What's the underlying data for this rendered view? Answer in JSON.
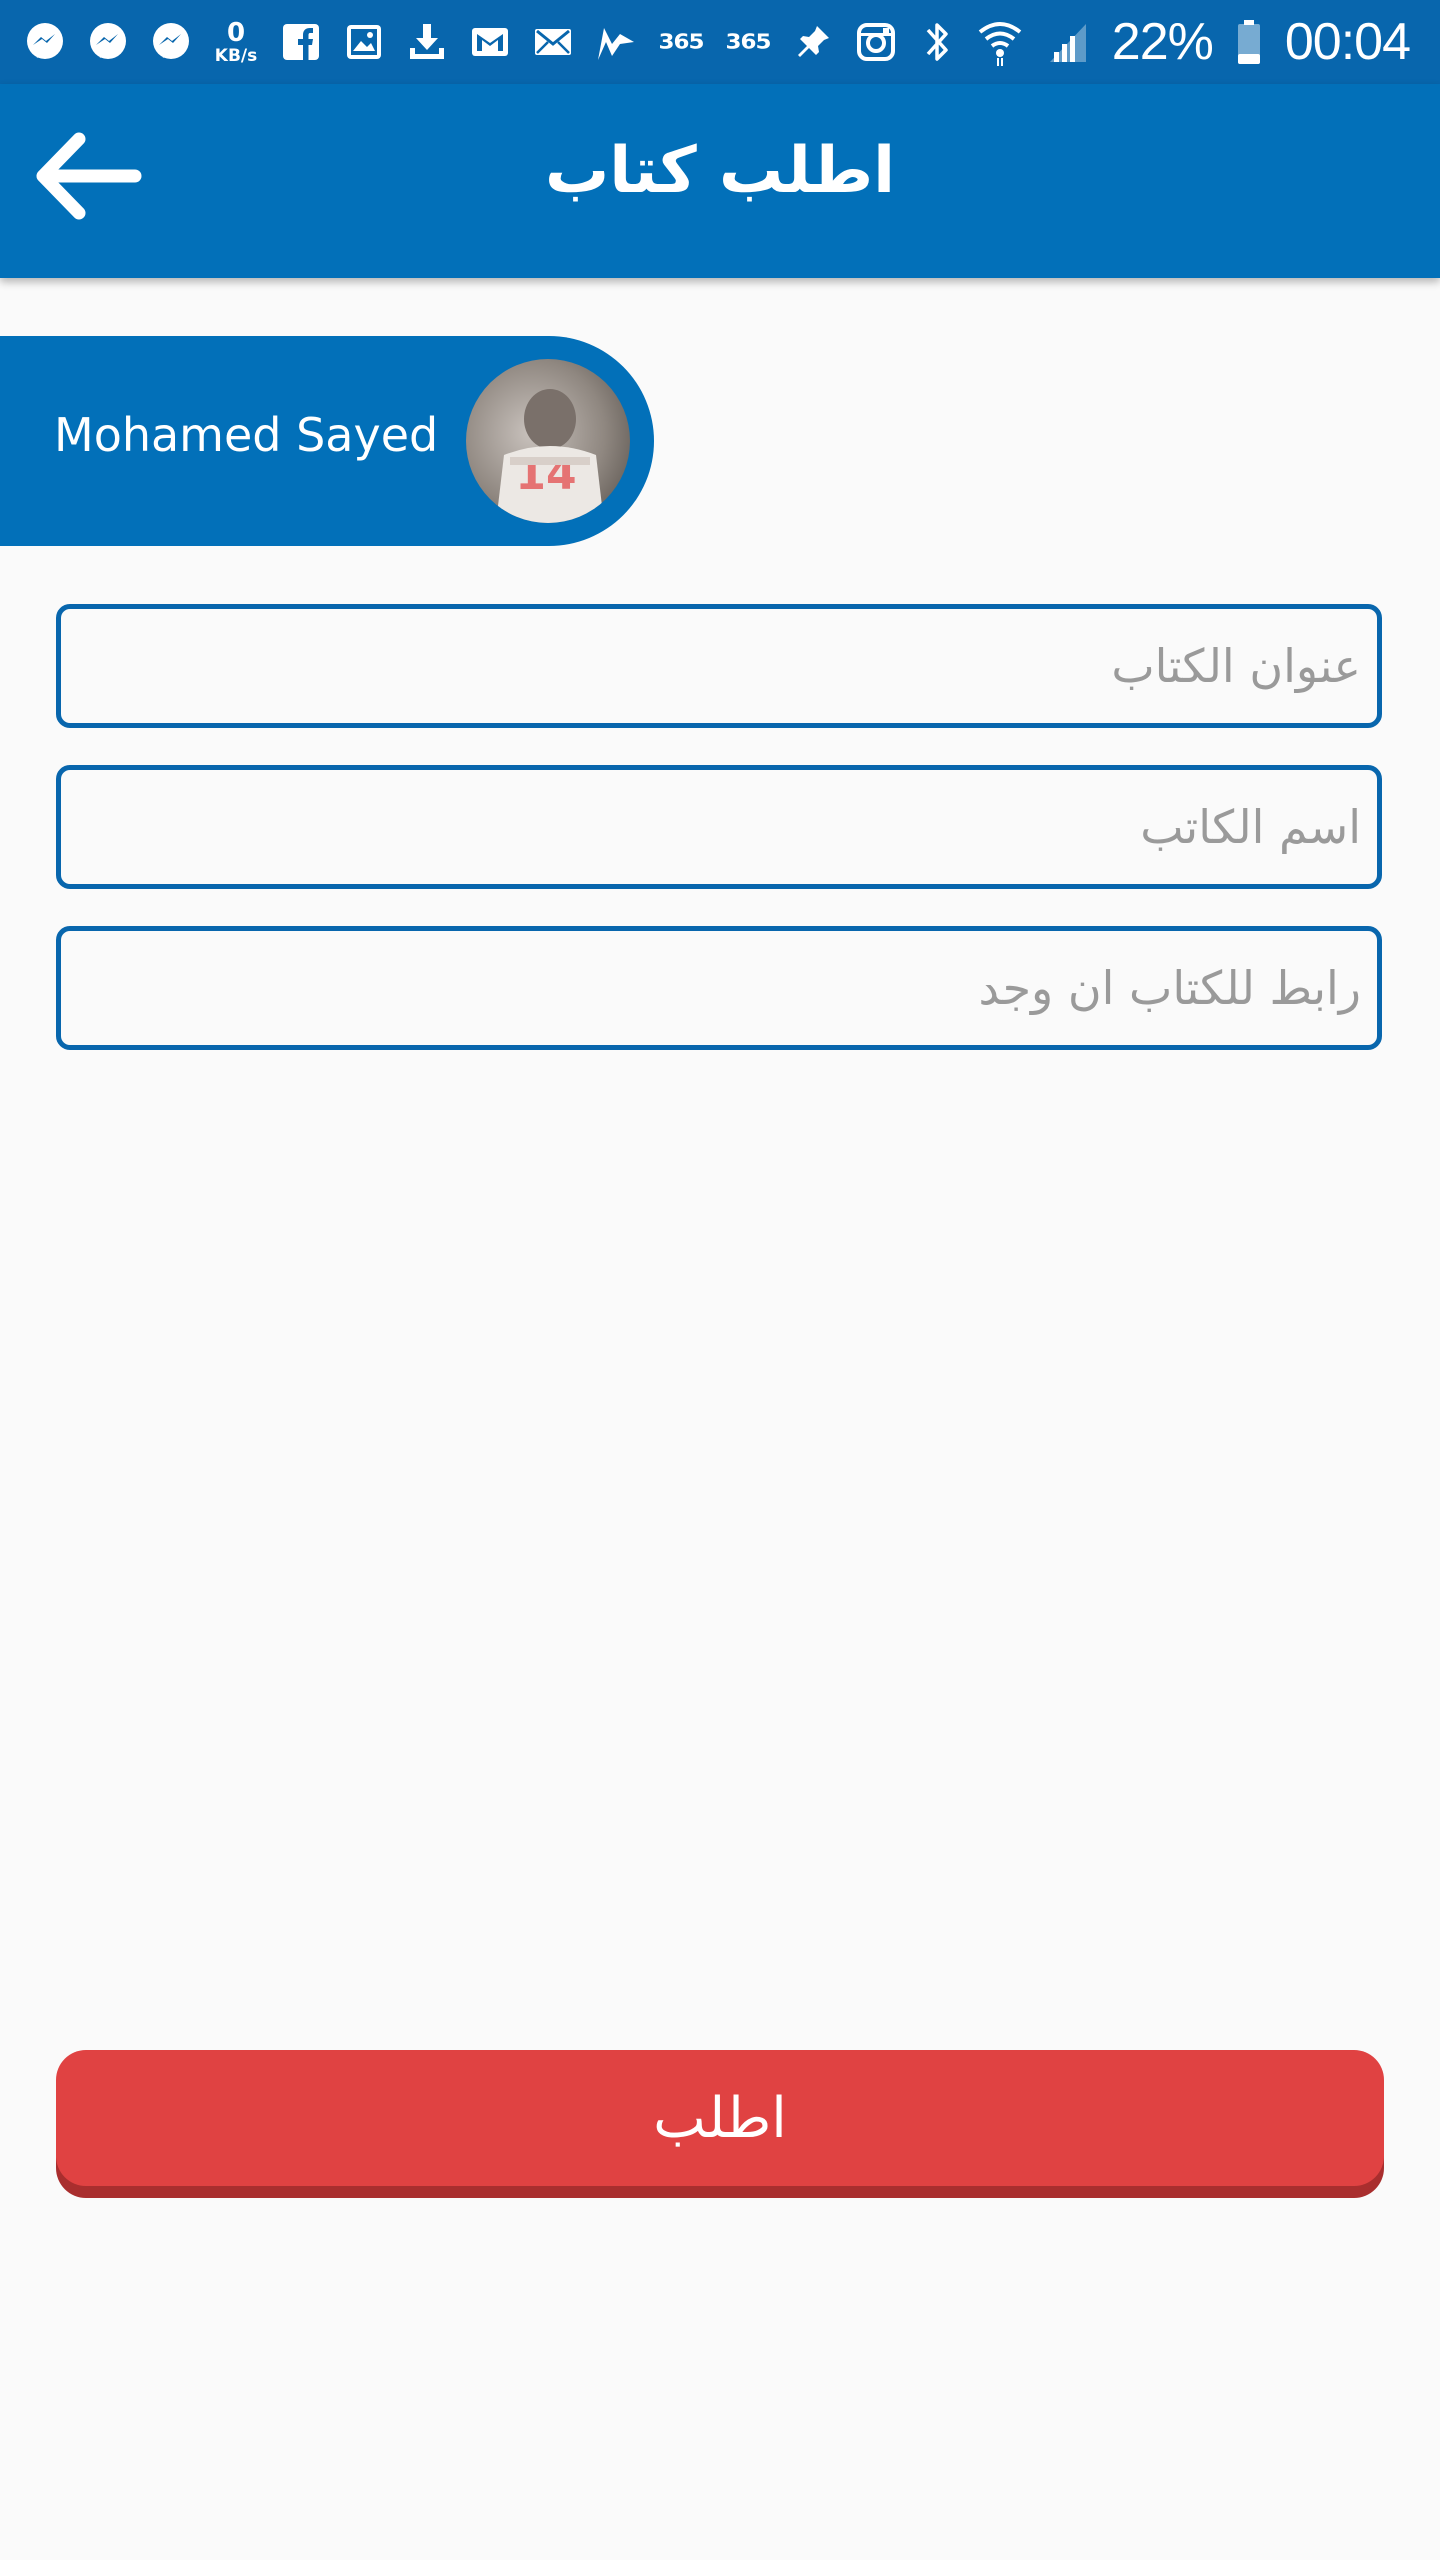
{
  "status_bar": {
    "net_speed_value": "0",
    "net_speed_unit": "KB/s",
    "app365_a": "365",
    "app365_b": "365",
    "battery_percent": "22%",
    "time": "00:04",
    "left_icons": [
      "messenger-icon",
      "messenger-icon",
      "messenger-icon",
      "net-speed",
      "facebook-icon",
      "gallery-icon",
      "download-icon",
      "gmail-icon",
      "email-icon",
      "chart-app-icon",
      "app-365",
      "app-365",
      "pin-icon",
      "instagram-icon"
    ],
    "right_icons": [
      "bluetooth-icon",
      "wifi-icon",
      "signal-icon",
      "battery-icon"
    ]
  },
  "app_bar": {
    "back_icon": "arrow-left-icon",
    "title": "اطلب كتاب"
  },
  "user": {
    "name": "Mohamed Sayed",
    "avatar_icon": "user-avatar"
  },
  "form": {
    "book_title_placeholder": "عنوان الكتاب",
    "author_name_placeholder": "اسم الكاتب",
    "book_link_placeholder": "رابط للكتاب ان وجد",
    "submit_label": "اطلب"
  },
  "colors": {
    "status_bar": "#0866ad",
    "primary": "#0270b9",
    "field_border": "#0866ad",
    "background": "#fafafa",
    "accent_button": "#e04242",
    "accent_button_shadow": "#a92e2e",
    "placeholder_text": "#9a9a9a"
  }
}
